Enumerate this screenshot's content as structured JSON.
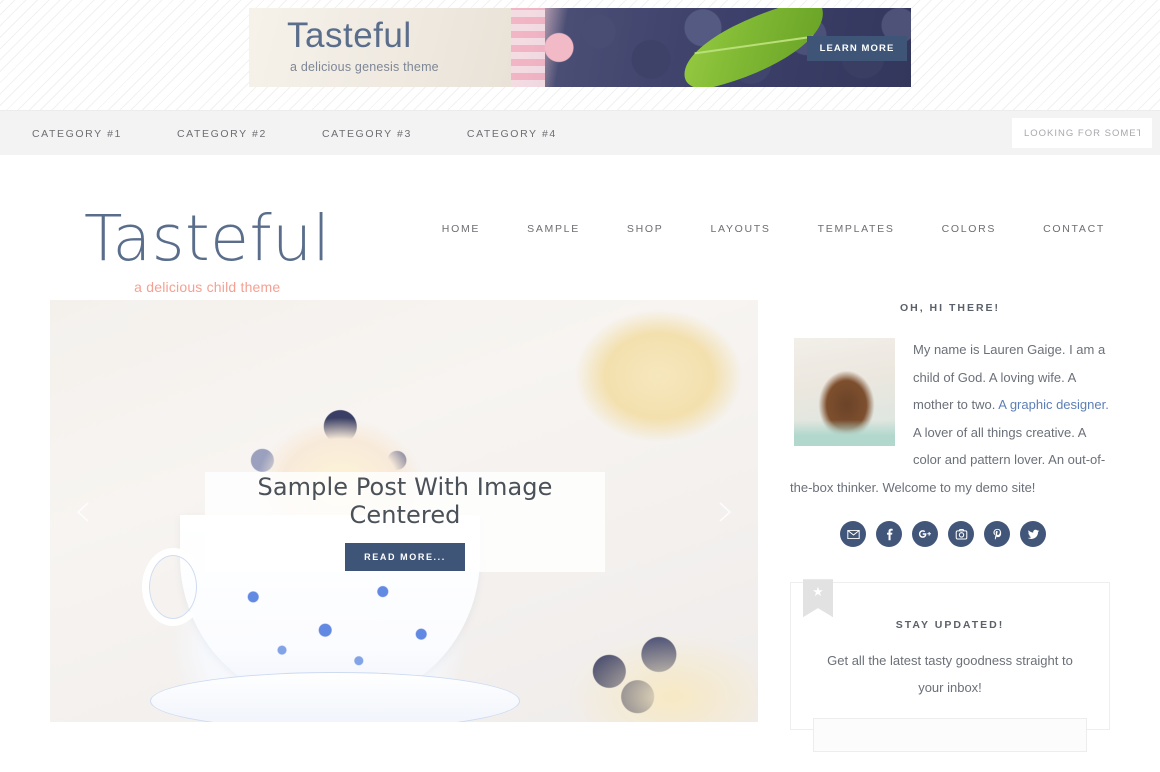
{
  "banner": {
    "title": "Tasteful",
    "subtitle": "a delicious genesis theme",
    "cta_label": "LEARN MORE",
    "cta_color": "#3f5578"
  },
  "category_nav": {
    "items": [
      {
        "label": "CATEGORY #1"
      },
      {
        "label": "CATEGORY #2"
      },
      {
        "label": "CATEGORY #3"
      },
      {
        "label": "CATEGORY #4"
      }
    ],
    "search": {
      "placeholder": "LOOKING FOR SOMETHING",
      "value": ""
    }
  },
  "site": {
    "title": "Tasteful",
    "tagline": "a delicious child theme",
    "title_color": "#5a6e8c",
    "tagline_color": "#f4a193"
  },
  "main_nav": {
    "items": [
      {
        "label": "HOME"
      },
      {
        "label": "SAMPLE"
      },
      {
        "label": "SHOP"
      },
      {
        "label": "LAYOUTS"
      },
      {
        "label": "TEMPLATES"
      },
      {
        "label": "COLORS"
      },
      {
        "label": "CONTACT"
      }
    ]
  },
  "slider": {
    "slide_title": "Sample Post With Image Centered",
    "read_more_label": "READ MORE...",
    "prev_label": "Previous slide",
    "next_label": "Next slide",
    "button_color": "#3f5578"
  },
  "sidebar": {
    "about": {
      "title": "OH, HI THERE!",
      "text_before_link": "My name is Lauren Gaige. I am a child of God. A loving wife. A mother to two. ",
      "link_text": "A graphic designer.",
      "text_after_link": " A lover of all things creative. A color and pattern lover. An out-of-the-box thinker. Welcome to my demo site!",
      "link_color": "#5d7fb8"
    },
    "socials": [
      {
        "name": "email",
        "glyph": "✉"
      },
      {
        "name": "facebook",
        "glyph": "f"
      },
      {
        "name": "google-plus",
        "glyph": "g+"
      },
      {
        "name": "instagram",
        "glyph": "▣"
      },
      {
        "name": "pinterest",
        "glyph": "P"
      },
      {
        "name": "twitter",
        "glyph": "ᵗ"
      }
    ],
    "optin": {
      "title": "STAY UPDATED!",
      "text": "Get all the latest tasty goodness straight to your inbox!",
      "input_value": "",
      "input_placeholder": "",
      "badge_icon": "star-icon",
      "badge_glyph": "★"
    }
  }
}
